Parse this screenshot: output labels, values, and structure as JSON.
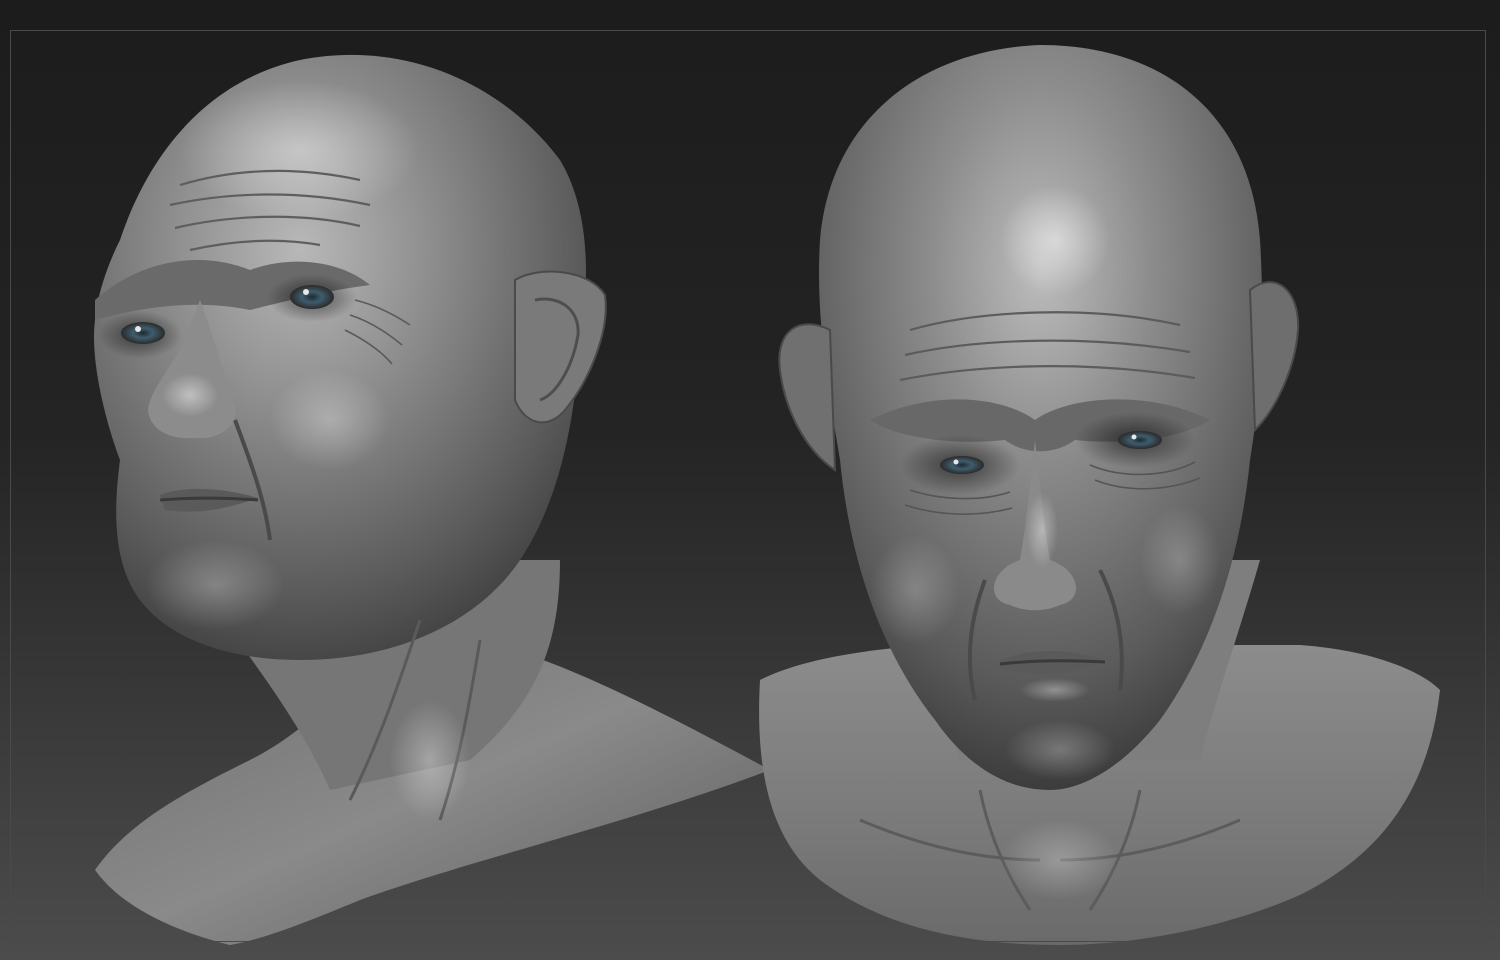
{
  "scene": {
    "background_top": "#232323",
    "background_bottom": "#4a4a4a",
    "border_color": "#4a4a4a",
    "material_base": "#7d7d7d",
    "material_highlight": "#bdbdbd",
    "material_shadow": "#3a3a3a",
    "eye_color": "#3f5d6e"
  },
  "renders": [
    {
      "id": "three-quarter-view",
      "description_name": "sculpt-head-three-quarter-view"
    },
    {
      "id": "front-view",
      "description_name": "sculpt-head-front-view"
    }
  ]
}
